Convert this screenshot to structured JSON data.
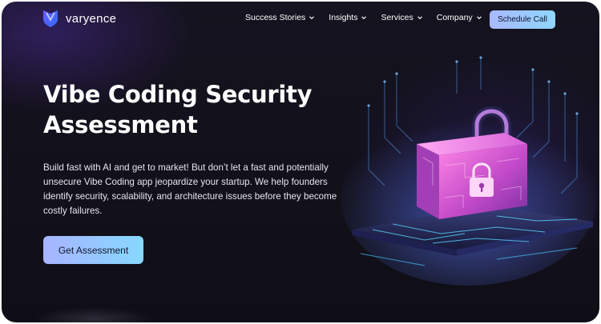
{
  "brand": {
    "name": "varyence"
  },
  "nav": {
    "items": [
      {
        "label": "Success Stories"
      },
      {
        "label": "Insights"
      },
      {
        "label": "Services"
      },
      {
        "label": "Company"
      }
    ],
    "cta_label": "Schedule Call"
  },
  "hero": {
    "title_line1": "Vibe Coding Security",
    "title_line2": "Assessment",
    "description": "Build fast with AI and get to market! But don’t let a fast and potentially unsecure Vibe Coding app jeopardize your startup. We help founders identify security, scalability, and architecture issues before they become costly failures.",
    "cta_label": "Get Assessment"
  },
  "icons": {
    "logo": "logo-shield-icon",
    "menu_chevron": "chevron-down-icon",
    "illustration": "padlock-circuit-icon"
  },
  "colors": {
    "background": "#121019",
    "accent_from": "#a8b4ff",
    "accent_to": "#86d8ff",
    "lock_pink": "#e36ad6",
    "circuit_cyan": "#4fd6ff"
  }
}
